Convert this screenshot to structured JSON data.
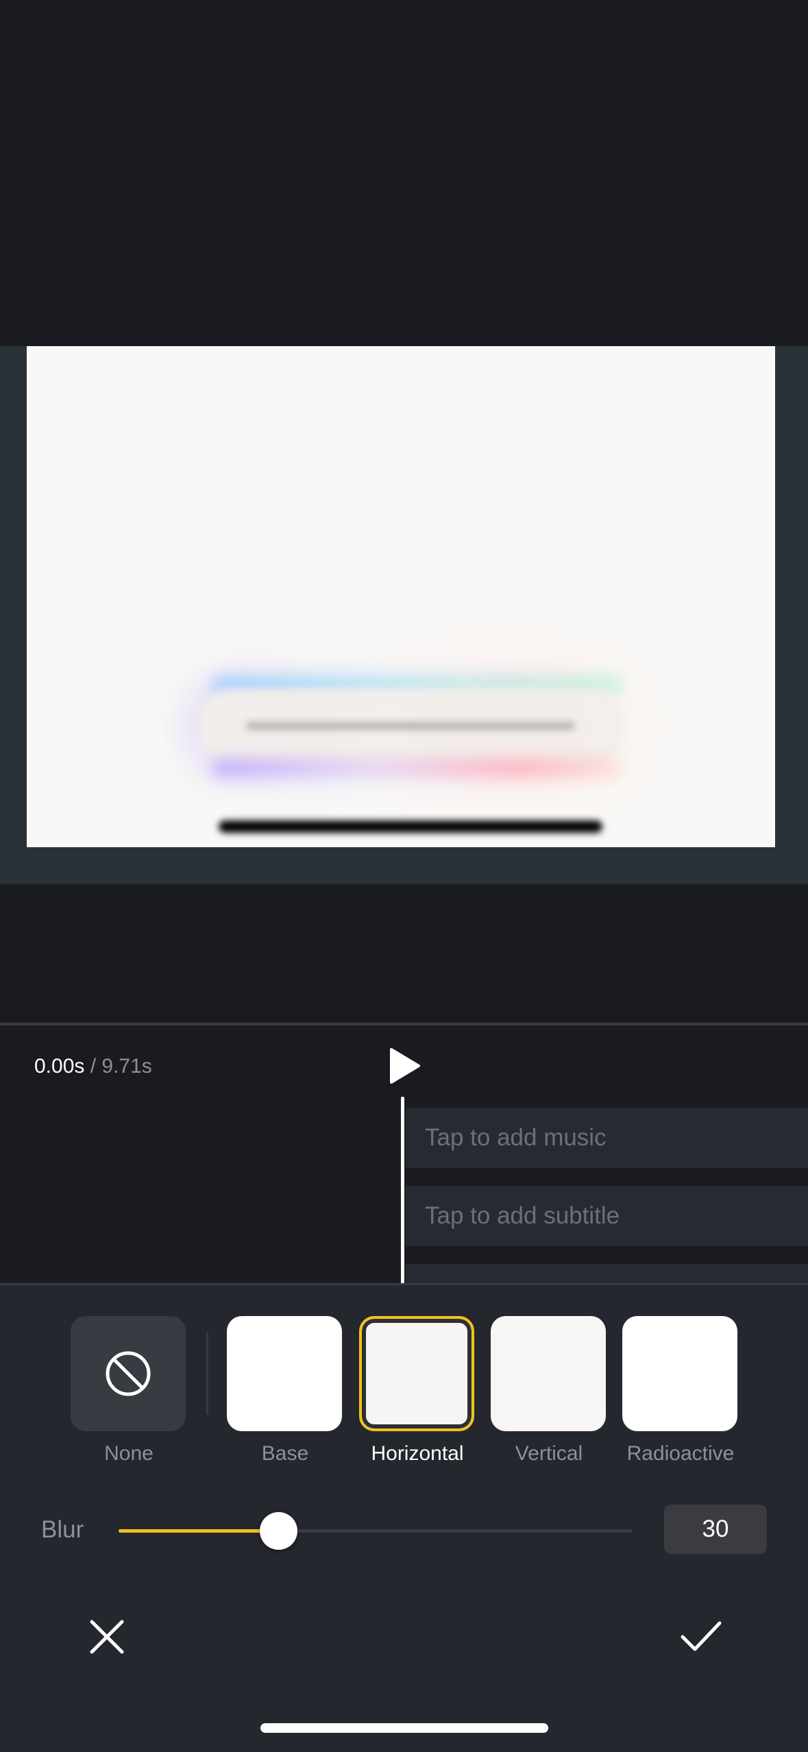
{
  "timeline": {
    "current_time": "0.00s",
    "separator": " / ",
    "total_time": "9.71s",
    "music_placeholder": "Tap to add music",
    "subtitle_placeholder": "Tap to add subtitle"
  },
  "effects": [
    {
      "label": "None",
      "icon": "prohibit-icon",
      "selected": false
    },
    {
      "label": "Base",
      "selected": false
    },
    {
      "label": "Horizontal",
      "selected": true
    },
    {
      "label": "Vertical",
      "selected": false
    },
    {
      "label": "Radioactive",
      "selected": false
    }
  ],
  "blur": {
    "label": "Blur",
    "value": "30",
    "level_fraction": 0.31
  },
  "colors": {
    "accent": "#f3c21a",
    "background": "#1a1b20",
    "panel": "#25272e"
  },
  "icons": {
    "play": "play-icon",
    "cancel": "close-icon",
    "confirm": "checkmark-icon"
  }
}
